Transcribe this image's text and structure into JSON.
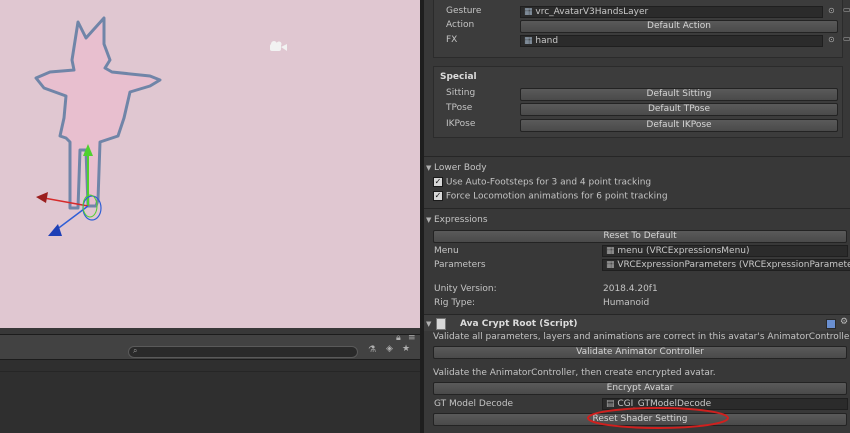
{
  "inspector": {
    "gesture_label": "Gesture",
    "gesture_value": "vrc_AvatarV3HandsLayer",
    "action_label": "Action",
    "action_button": "Default Action",
    "fx_label": "FX",
    "fx_value": "hand",
    "special": {
      "title": "Special",
      "sitting_label": "Sitting",
      "sitting_button": "Default Sitting",
      "tpose_label": "TPose",
      "tpose_button": "Default TPose",
      "ikpose_label": "IKPose",
      "ikpose_button": "Default IKPose"
    },
    "lower_body": {
      "title": "Lower Body",
      "auto_footsteps": "Use Auto-Footsteps for 3 and 4 point tracking",
      "force_locomotion": "Force Locomotion animations for 6 point tracking"
    },
    "expressions": {
      "title": "Expressions",
      "reset_button": "Reset To Default",
      "menu_label": "Menu",
      "menu_value": "menu (VRCExpressionsMenu)",
      "parameters_label": "Parameters",
      "parameters_value": "VRCExpressionParameters (VRCExpressionParamete"
    },
    "unity_version_label": "Unity Version:",
    "unity_version_value": "2018.4.20f1",
    "rig_type_label": "Rig Type:",
    "rig_type_value": "Humanoid",
    "component": {
      "title": "Ava Crypt Root (Script)",
      "validate_desc": "Validate all parameters, layers and animations are correct in this avatar's AnimatorController.",
      "validate_button": "Validate Animator Controller",
      "encrypt_desc": "Validate the AnimatorController, then create encrypted avatar.",
      "encrypt_button": "Encrypt Avatar",
      "gt_label": "GT Model Decode",
      "gt_value": "CGI_GTModelDecode",
      "reset_shader_button": "Reset Shader Setting"
    }
  },
  "colors": {
    "scene_bg": "#e0c7d1",
    "highlight_ellipse": "#d0201e",
    "inspector_bg": "#383838"
  }
}
